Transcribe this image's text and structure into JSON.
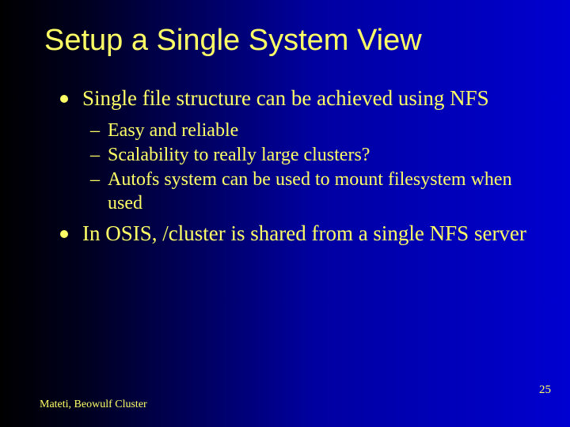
{
  "slide": {
    "title": "Setup a Single System View",
    "bullets": [
      {
        "text": "Single file structure can be achieved using NFS",
        "sub": [
          "Easy and reliable",
          "Scalability to really large clusters?",
          "Autofs system can be used to mount filesystem when used"
        ]
      },
      {
        "text": "In OSIS, /cluster is shared from a single NFS server",
        "sub": []
      }
    ],
    "footer": {
      "author": "Mateti, Beowulf Cluster",
      "page": "25"
    }
  }
}
